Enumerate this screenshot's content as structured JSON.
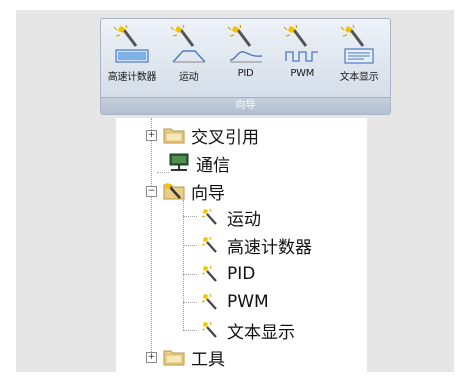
{
  "ribbon": {
    "buttons": [
      {
        "label": "高速计数器",
        "icon": "wizard-hsc-icon"
      },
      {
        "label": "运动",
        "icon": "wizard-motion-icon"
      },
      {
        "label": "PID",
        "icon": "wizard-pid-icon"
      },
      {
        "label": "PWM",
        "icon": "wizard-pwm-icon"
      },
      {
        "label": "文本显示",
        "icon": "wizard-text-display-icon"
      }
    ],
    "group_label": "向导"
  },
  "tree": {
    "items": [
      {
        "label": "交叉引用",
        "icon": "folder-icon",
        "expander": "+"
      },
      {
        "label": "通信",
        "icon": "network-icon"
      },
      {
        "label": "向导",
        "icon": "wizard-folder-icon",
        "expander": "−"
      },
      {
        "label": "运动",
        "icon": "wand-icon"
      },
      {
        "label": "高速计数器",
        "icon": "wand-icon"
      },
      {
        "label": "PID",
        "icon": "wand-icon"
      },
      {
        "label": "PWM",
        "icon": "wand-icon"
      },
      {
        "label": "文本显示",
        "icon": "wand-icon"
      },
      {
        "label": "工具",
        "icon": "folder-icon",
        "expander": "+"
      }
    ]
  },
  "colors": {
    "ribbon_bg": "#dfe6ef",
    "folder": "#e8c878",
    "wand_yellow": "#f2c400"
  }
}
